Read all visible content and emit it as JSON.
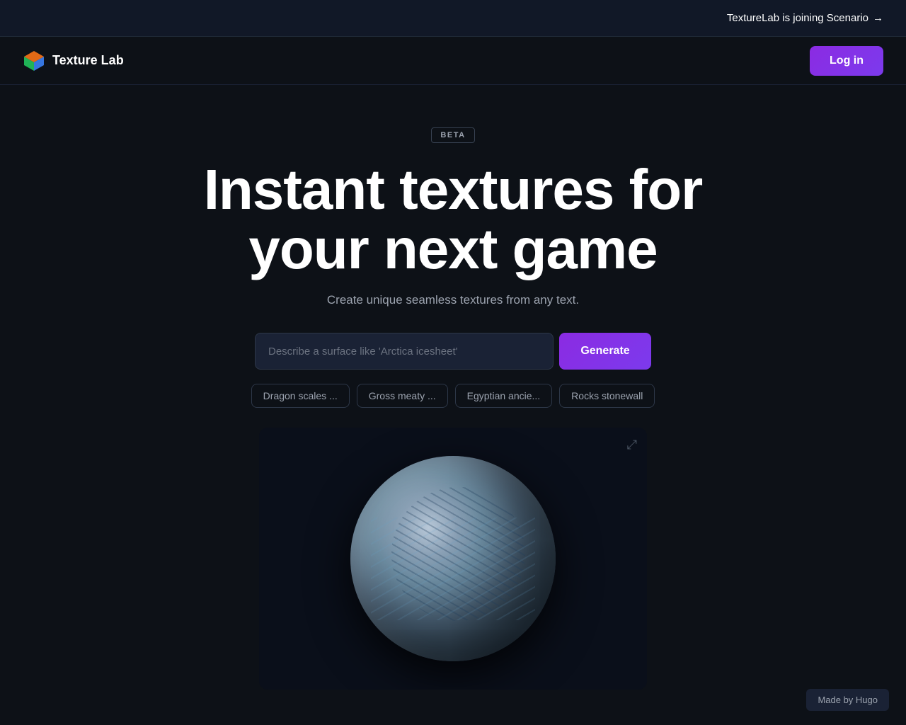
{
  "announcement": {
    "text": "TextureLab is joining Scenario",
    "arrow": "→"
  },
  "nav": {
    "logo_name": "Texture Lab",
    "login_label": "Log in"
  },
  "hero": {
    "beta_label": "BETA",
    "title_line1": "Instant textures for",
    "title_line2": "your next game",
    "subtitle": "Create unique seamless textures from any text.",
    "input_placeholder": "Describe a surface like 'Arctica icesheet'",
    "generate_label": "Generate"
  },
  "chips": [
    {
      "label": "Dragon scales ..."
    },
    {
      "label": "Gross meaty ..."
    },
    {
      "label": "Egyptian ancie..."
    },
    {
      "label": "Rocks stonewall"
    }
  ],
  "footer": {
    "made_by": "Made by Hugo"
  }
}
